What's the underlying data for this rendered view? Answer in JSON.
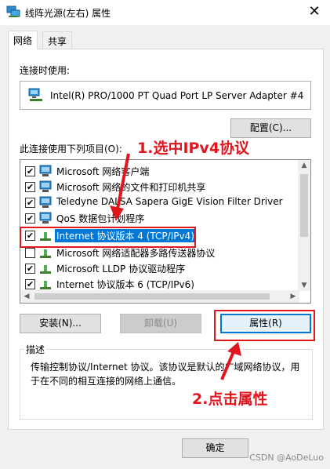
{
  "window": {
    "title": "线阵光源(左右) 属性",
    "close_glyph": "✕"
  },
  "tabs": [
    {
      "label": "网络",
      "active": true
    },
    {
      "label": "共享",
      "active": false
    }
  ],
  "connect_using": {
    "label": "连接时使用:",
    "adapter": "Intel(R) PRO/1000 PT Quad Port LP Server Adapter #4",
    "configure_button": "配置(C)..."
  },
  "items_section": {
    "label": "此连接使用下列项目(O):",
    "items": [
      {
        "label": "Microsoft 网络客户端",
        "checked": true,
        "icon": "network-client-icon",
        "selected": false
      },
      {
        "label": "Microsoft 网络的文件和打印机共享",
        "checked": true,
        "icon": "file-printer-sharing-icon",
        "selected": false
      },
      {
        "label": "Teledyne DALSA Sapera GigE Vision Filter Driver",
        "checked": true,
        "icon": "network-client-icon",
        "selected": false
      },
      {
        "label": "QoS 数据包计划程序",
        "checked": true,
        "icon": "network-client-icon",
        "selected": false
      },
      {
        "label": "Internet 协议版本 4 (TCP/IPv4)",
        "checked": true,
        "icon": "protocol-icon",
        "selected": true
      },
      {
        "label": "Microsoft 网络适配器多路传送器协议",
        "checked": false,
        "icon": "protocol-icon",
        "selected": false
      },
      {
        "label": "Microsoft LLDP 协议驱动程序",
        "checked": true,
        "icon": "protocol-icon",
        "selected": false
      },
      {
        "label": "Internet 协议版本 6 (TCP/IPv6)",
        "checked": true,
        "icon": "protocol-icon",
        "selected": false
      }
    ]
  },
  "buttons": {
    "install": "安装(N)...",
    "uninstall": "卸载(U)",
    "properties": "属性(R)",
    "ok": "确定"
  },
  "description": {
    "legend": "描述",
    "text": "传输控制协议/Internet 协议。该协议是默认的广域网络协议，用于在不同的相互连接的网络上通信。"
  },
  "annotations": {
    "step1": "1.选中IPv4协议",
    "step2": "2.点击属性",
    "color": "#e0161f"
  },
  "watermark": "CSDN @AoDeLuo",
  "colors": {
    "selection": "#0078d7",
    "focus_border": "#0078d7",
    "annotation_red": "#e0161f"
  }
}
